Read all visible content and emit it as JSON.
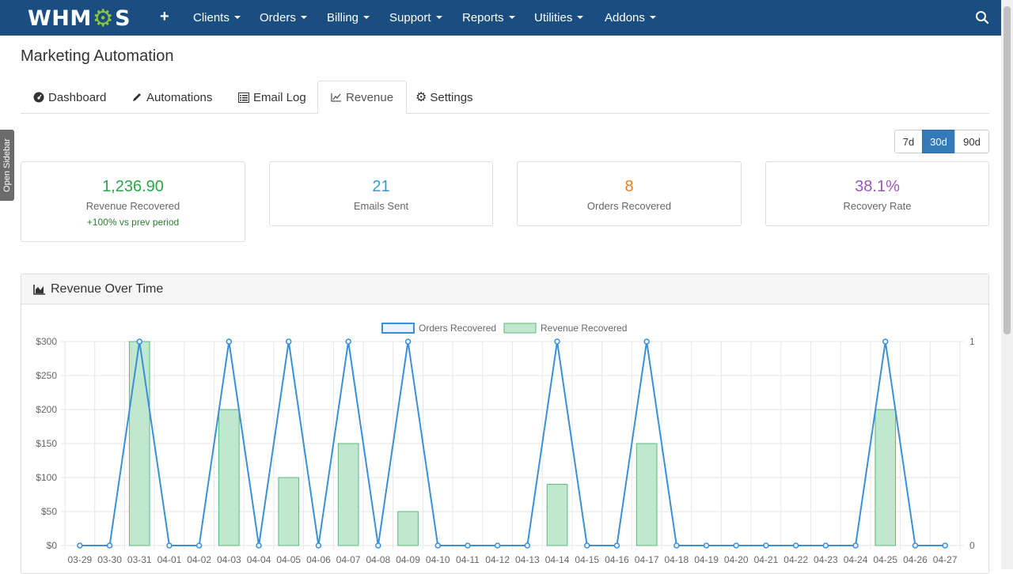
{
  "nav": {
    "logo": {
      "pre": "WHM",
      "post": "S"
    },
    "plus": "+",
    "menus": [
      "Clients",
      "Orders",
      "Billing",
      "Support",
      "Reports",
      "Utilities",
      "Addons"
    ]
  },
  "sidebar": {
    "label": "Open Sidebar"
  },
  "page": {
    "title": "Marketing Automation"
  },
  "tabs": [
    {
      "label": "Dashboard",
      "icon": "dashboard-icon"
    },
    {
      "label": "Automations",
      "icon": "pencil-icon"
    },
    {
      "label": "Email Log",
      "icon": "list-icon"
    },
    {
      "label": "Revenue",
      "icon": "line-chart-icon",
      "active": true
    },
    {
      "label": "Settings",
      "icon": "gear-icon"
    }
  ],
  "ranges": [
    {
      "label": "7d"
    },
    {
      "label": "30d",
      "active": true
    },
    {
      "label": "90d"
    }
  ],
  "stats": [
    {
      "value": "1,236.90",
      "label": "Revenue Recovered",
      "sub": "+100% vs prev period",
      "color": "#28a745"
    },
    {
      "value": "21",
      "label": "Emails Sent",
      "color": "#2a9fd6"
    },
    {
      "value": "8",
      "label": "Orders Recovered",
      "color": "#e67e22"
    },
    {
      "value": "38.1%",
      "label": "Recovery Rate",
      "color": "#9b59b6"
    }
  ],
  "panel": {
    "title": "Revenue Over Time"
  },
  "chart_data": {
    "type": "bar",
    "title": "",
    "categories": [
      "03-29",
      "03-30",
      "03-31",
      "04-01",
      "04-02",
      "04-03",
      "04-04",
      "04-05",
      "04-06",
      "04-07",
      "04-08",
      "04-09",
      "04-10",
      "04-11",
      "04-12",
      "04-13",
      "04-14",
      "04-15",
      "04-16",
      "04-17",
      "04-18",
      "04-19",
      "04-20",
      "04-21",
      "04-22",
      "04-23",
      "04-24",
      "04-25",
      "04-26",
      "04-27"
    ],
    "series": [
      {
        "name": "Orders Recovered",
        "type": "line",
        "axis": "right",
        "color": "#3a8fd9",
        "values": [
          0,
          0,
          1,
          0,
          0,
          1,
          0,
          1,
          0,
          1,
          0,
          1,
          0,
          0,
          0,
          0,
          1,
          0,
          0,
          1,
          0,
          0,
          0,
          0,
          0,
          0,
          0,
          1,
          0,
          0
        ]
      },
      {
        "name": "Revenue Recovered",
        "type": "bar",
        "axis": "left",
        "color": "#bfe8cf",
        "border": "#5cb87a",
        "values": [
          0,
          0,
          300,
          0,
          0,
          200,
          0,
          100,
          0,
          150,
          0,
          50,
          0,
          0,
          0,
          0,
          90,
          0,
          0,
          150,
          0,
          0,
          0,
          0,
          0,
          0,
          0,
          200,
          0,
          0
        ]
      }
    ],
    "yLeft": {
      "min": 0,
      "max": 300,
      "ticks": [
        "$0",
        "$50",
        "$100",
        "$150",
        "$200",
        "$250",
        "$300"
      ],
      "tickValues": [
        0,
        50,
        100,
        150,
        200,
        250,
        300
      ]
    },
    "yRight": {
      "min": 0,
      "max": 1,
      "ticks": [
        "0",
        "1"
      ],
      "tickValues": [
        0,
        1
      ]
    },
    "legend": "top-center",
    "grid": true
  }
}
